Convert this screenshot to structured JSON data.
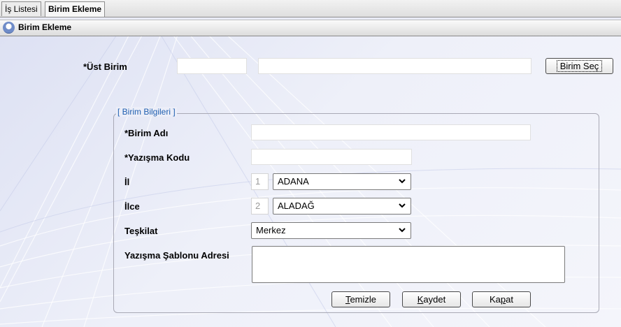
{
  "tabs": [
    {
      "label": "İş Listesi",
      "active": false
    },
    {
      "label": "Birim Ekleme",
      "active": true
    }
  ],
  "window": {
    "title": "Birim Ekleme",
    "icon": "person-icon"
  },
  "ust_birim": {
    "label": "*Üst Birim",
    "code_value": "",
    "name_value": "",
    "select_button_label": "Birim Seç"
  },
  "group": {
    "legend": "[ Birim Bilgileri ]",
    "birim_adi": {
      "label": "*Birim Adı",
      "value": ""
    },
    "yazisma_kodu": {
      "label": "*Yazışma Kodu",
      "value": ""
    },
    "il": {
      "label": "İl",
      "code": "1",
      "selected": "ADANA"
    },
    "ilce": {
      "label": "İlce",
      "code": "2",
      "selected": "ALADAĞ"
    },
    "teskilat": {
      "label": "Teşkilat",
      "selected": "Merkez"
    },
    "sablon": {
      "label": "Yazışma Şablonu Adresi",
      "value": ""
    }
  },
  "buttons": {
    "temizle": {
      "accel": "T",
      "rest": "emizle"
    },
    "kaydet": {
      "accel": "K",
      "rest": "aydet"
    },
    "kapat_pre": "Ka",
    "kapat_accel": "p",
    "kapat_post": "at"
  },
  "colors": {
    "legend": "#1f5fb0",
    "background": "#e9ebf6"
  }
}
